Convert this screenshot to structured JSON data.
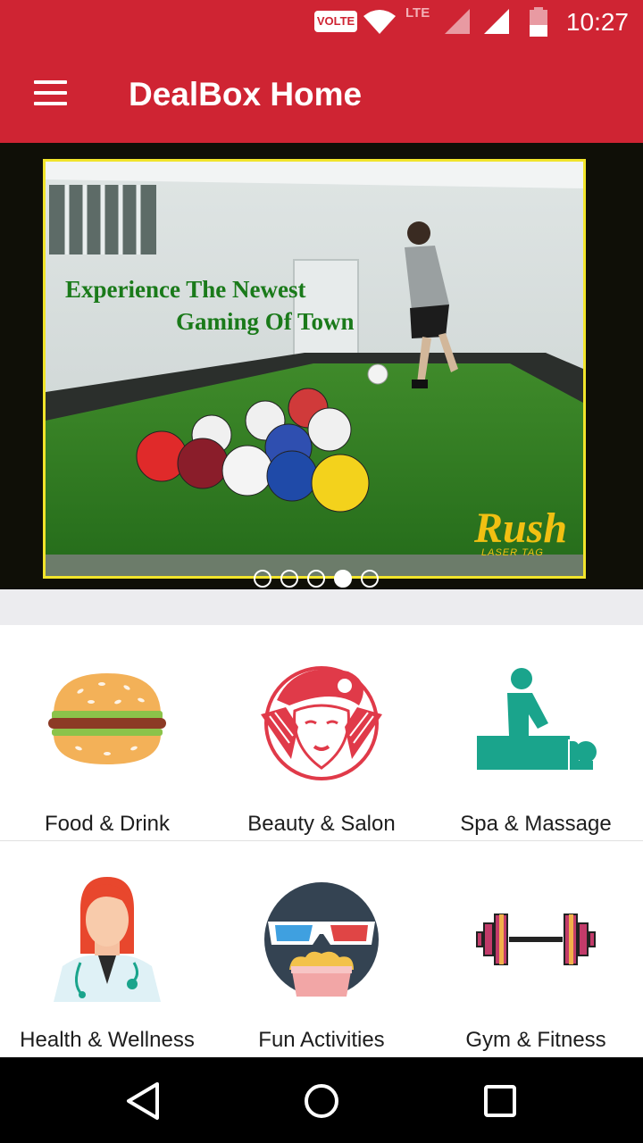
{
  "status_bar": {
    "volte": "VOLTE",
    "lte": "LTE",
    "time": "10:27",
    "icons": [
      "wifi-icon",
      "signal-icon",
      "signal-icon",
      "battery-icon"
    ]
  },
  "app_bar": {
    "title": "DealBox Home",
    "menu_icon": "menu-icon"
  },
  "banner": {
    "headline_line1": "Experience The Newest",
    "headline_line2": "Gaming Of Town",
    "brand": "Rush",
    "brand_sub": "LASER TAG",
    "slide_count": 5,
    "active_slide": 4
  },
  "categories": [
    {
      "label": "Food & Drink",
      "icon": "burger-icon"
    },
    {
      "label": "Beauty & Salon",
      "icon": "woman-face-icon"
    },
    {
      "label": "Spa & Massage",
      "icon": "massage-icon"
    },
    {
      "label": "Health & Wellness",
      "icon": "doctor-icon"
    },
    {
      "label": "Fun Activities",
      "icon": "3d-glasses-popcorn-icon"
    },
    {
      "label": "Gym & Fitness",
      "icon": "dumbbell-icon"
    }
  ],
  "nav_bar": {
    "back": "back-icon",
    "home": "home-icon",
    "recents": "recents-icon"
  },
  "colors": {
    "primary": "#cf2433",
    "banner_border": "#f1e42b",
    "teal": "#1aa48c"
  }
}
